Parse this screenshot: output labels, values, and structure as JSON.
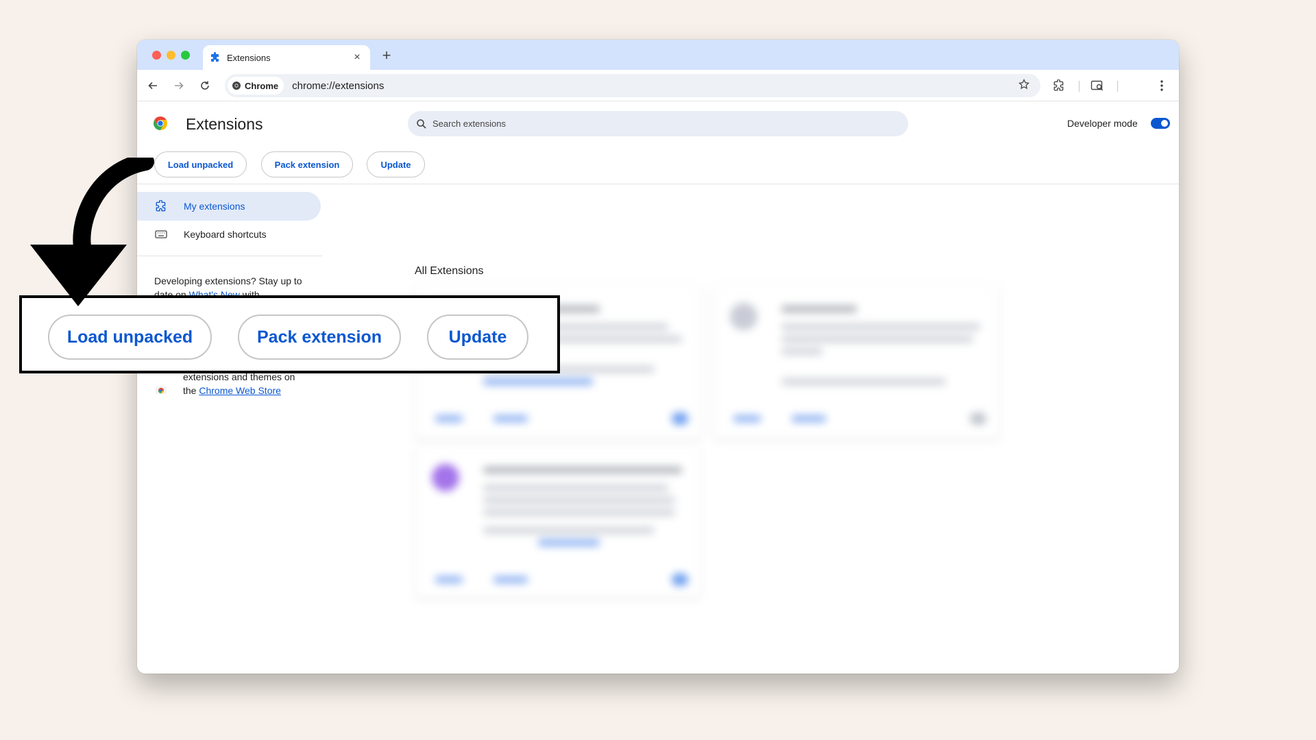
{
  "browser": {
    "tab_title": "Extensions",
    "tab_close": "×",
    "new_tab": "+",
    "site_chip": "Chrome",
    "url": "chrome://extensions"
  },
  "page": {
    "title": "Extensions",
    "search_placeholder": "Search extensions",
    "developer_mode_label": "Developer mode",
    "developer_mode_on": true,
    "buttons": {
      "load_unpacked": "Load unpacked",
      "pack_extension": "Pack extension",
      "update": "Update"
    },
    "sidebar": {
      "items": [
        {
          "label": "My extensions",
          "icon": "puzzle-icon",
          "selected": true
        },
        {
          "label": "Keyboard shortcuts",
          "icon": "keyboard-icon",
          "selected": false
        }
      ],
      "dev_text_1": "Developing extensions? Stay up to date on ",
      "dev_link": "What's New",
      "dev_text_2": " with",
      "store_text_1": "extensions and themes on the ",
      "store_link": "Chrome Web Store"
    },
    "section_title": "All Extensions"
  },
  "callout": {
    "load_unpacked": "Load unpacked",
    "pack_extension": "Pack extension",
    "update": "Update"
  },
  "colors": {
    "accent": "#0b57d0",
    "titlebar": "#d3e3fd",
    "background": "#f8f1eb"
  }
}
